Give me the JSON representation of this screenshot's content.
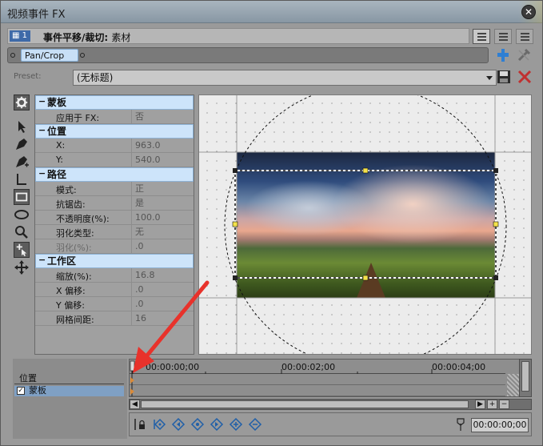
{
  "window": {
    "title": "视频事件 FX",
    "close_glyph": "✕"
  },
  "chain": {
    "index": "1",
    "label": "事件平移/裁切:",
    "source": "素材"
  },
  "plugin": {
    "name": "Pan/Crop"
  },
  "preset": {
    "label": "Preset:",
    "value": "(无标题)"
  },
  "properties": {
    "sections": [
      {
        "title": "蒙板",
        "rows": [
          {
            "key": "应用于 FX:",
            "value": "否"
          }
        ]
      },
      {
        "title": "位置",
        "rows": [
          {
            "key": "X:",
            "value": "963.0"
          },
          {
            "key": "Y:",
            "value": "540.0"
          }
        ]
      },
      {
        "title": "路径",
        "rows": [
          {
            "key": "模式:",
            "value": "正"
          },
          {
            "key": "抗锯齿:",
            "value": "是"
          },
          {
            "key": "不透明度(%):",
            "value": "100.0"
          },
          {
            "key": "羽化类型:",
            "value": "无"
          },
          {
            "key": "羽化(%):",
            "value": ".0"
          }
        ]
      },
      {
        "title": "工作区",
        "rows": [
          {
            "key": "缩放(%):",
            "value": "16.8"
          },
          {
            "key": "X 偏移:",
            "value": ".0"
          },
          {
            "key": "Y 偏移:",
            "value": ".0"
          },
          {
            "key": "网格间距:",
            "value": "16"
          }
        ]
      }
    ]
  },
  "tracks": {
    "header": "位置",
    "mask_row": "蒙板",
    "mask_checked": "✓"
  },
  "timeline": {
    "ticks": [
      "00:00:00;00",
      "00:00:02;00",
      "00:00:04;00"
    ],
    "cursor_time": "00:00:00;00"
  },
  "colors": {
    "section_bg": "#cde4fa",
    "accent_blue": "#3e6aa8",
    "arrow_red": "#e8322b",
    "delete_red": "#c03030"
  }
}
